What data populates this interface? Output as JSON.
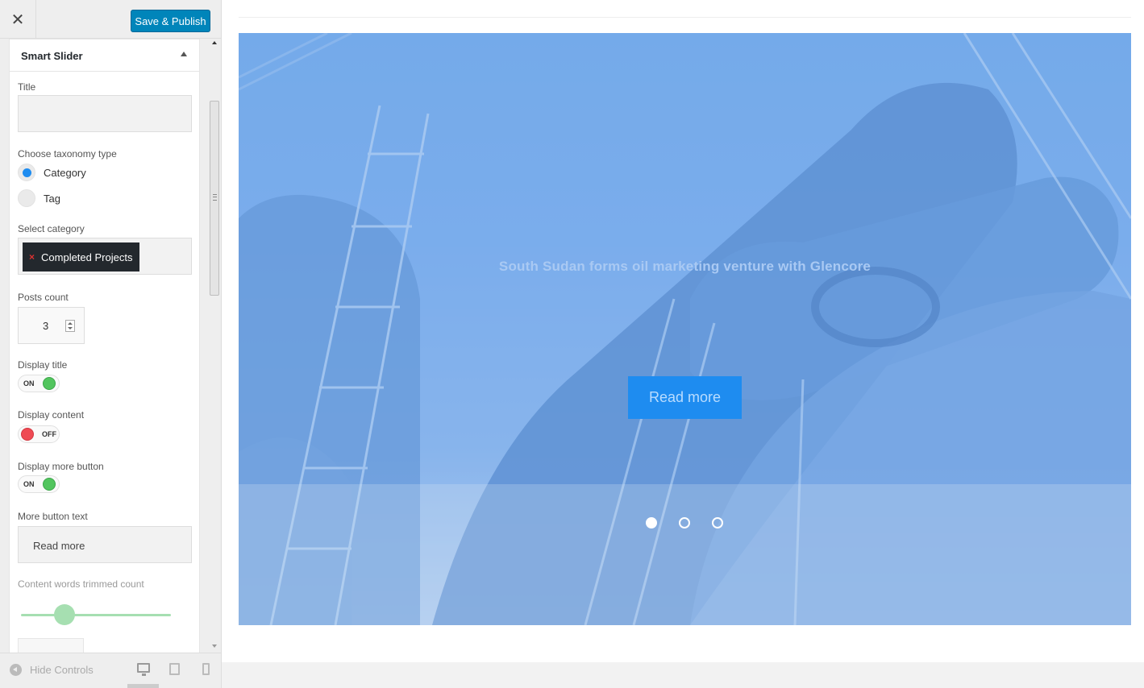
{
  "header": {
    "close_symbol": "✕",
    "publish_label": "Save & Publish"
  },
  "widget": {
    "title": "Smart Slider",
    "title_label": "Title",
    "title_value": "",
    "taxonomy_label": "Choose taxonomy type",
    "taxonomy_options": [
      {
        "label": "Category",
        "selected": true
      },
      {
        "label": "Tag",
        "selected": false
      }
    ],
    "category_label": "Select category",
    "selected_category": "Completed Projects",
    "remove_symbol": "×",
    "posts_count_label": "Posts count",
    "posts_count": "3",
    "display_title_label": "Display title",
    "display_title_state": "ON",
    "display_content_label": "Display content",
    "display_content_state": "OFF",
    "display_more_label": "Display more button",
    "display_more_state": "ON",
    "more_text_label": "More button text",
    "more_text_value": "Read more",
    "trim_label": "Content words trimmed count"
  },
  "footer": {
    "hide_controls": "Hide Controls",
    "devices": [
      "desktop-icon",
      "tablet-icon",
      "mobile-icon"
    ],
    "active_device": "desktop"
  },
  "preview": {
    "slide_title": "South Sudan forms oil marketing venture with Glencore",
    "slide_button": "Read more",
    "dots": 3,
    "active_dot": 1
  },
  "colors": {
    "publish": "#0085ba",
    "accent": "#1e8cf0",
    "toggle_on": "#52c55e",
    "toggle_off": "#ef4a53",
    "chip": "#23282d"
  }
}
